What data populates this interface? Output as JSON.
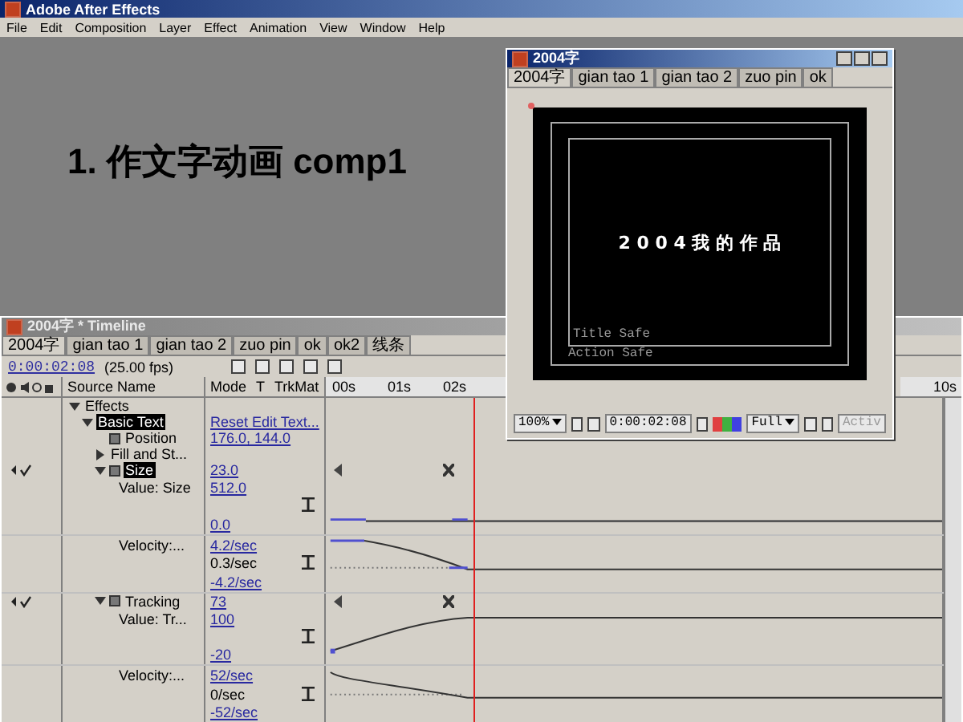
{
  "app": {
    "title": "Adobe After Effects",
    "menu": [
      "File",
      "Edit",
      "Composition",
      "Layer",
      "Effect",
      "Animation",
      "View",
      "Window",
      "Help"
    ]
  },
  "heading": "1. 作文字动画 comp1",
  "comp_window": {
    "title": "2004字",
    "tabs": [
      {
        "label": "2004字",
        "selected": true
      },
      {
        "label": "gian tao 1",
        "selected": false
      },
      {
        "label": "gian tao 2",
        "selected": false
      },
      {
        "label": "zuo pin",
        "selected": false
      },
      {
        "label": "ok",
        "selected": false
      }
    ],
    "preview_text": "2 0 0 4 我 的 作 品",
    "title_safe": "Title Safe",
    "action_safe": "Action Safe",
    "zoom": "100%",
    "timecode": "0:00:02:08",
    "resolution": "Full",
    "view": "Activ"
  },
  "timeline": {
    "title": "2004字 * Timeline",
    "tabs": [
      {
        "label": "2004字",
        "selected": true
      },
      {
        "label": "gian tao 1",
        "selected": false
      },
      {
        "label": "gian tao 2",
        "selected": false
      },
      {
        "label": "zuo pin",
        "selected": false
      },
      {
        "label": "ok",
        "selected": false
      },
      {
        "label": "ok2",
        "selected": false
      },
      {
        "label": "线条",
        "selected": false
      }
    ],
    "timecode": "0:00:02:08",
    "fps": "(25.00 fps)",
    "columns": [
      "Source Name",
      "Mode",
      "T",
      "TrkMat"
    ],
    "ruler": [
      "00s",
      "01s",
      "02s"
    ],
    "ruler_end": "10s",
    "rows": [
      {
        "kind": "property",
        "name": "Effects",
        "expanded": true,
        "selected": false,
        "children": [
          {
            "kind": "property",
            "name": "Basic Text",
            "value": "Reset Edit Text...",
            "expanded": true,
            "selected": true,
            "children": [
              {
                "kind": "property",
                "name": "Position",
                "value": "176.0, 144.0",
                "stopwatch": true,
                "selected": false
              },
              {
                "kind": "property",
                "name": "Fill and St...",
                "expanded": false,
                "selected": false
              },
              {
                "kind": "property",
                "name": "Size",
                "value": "23.0",
                "expanded": true,
                "selected": true,
                "stopwatch": true,
                "keyframed": true,
                "children": [
                  {
                    "kind": "graph",
                    "name": "Value: Size",
                    "labels": [
                      "512.0",
                      "0.0"
                    ]
                  },
                  {
                    "kind": "graph",
                    "name": "Velocity:...",
                    "labels": [
                      "4.2/sec",
                      "0.3/sec",
                      "-4.2/sec"
                    ]
                  }
                ]
              },
              {
                "kind": "property",
                "name": "Tracking",
                "value": "73",
                "expanded": true,
                "selected": false,
                "stopwatch": true,
                "keyframed": true,
                "children": [
                  {
                    "kind": "graph",
                    "name": "Value: Tr...",
                    "labels": [
                      "100",
                      "-20"
                    ]
                  },
                  {
                    "kind": "graph",
                    "name": "Velocity:...",
                    "labels": [
                      "52/sec",
                      "0/sec",
                      "-52/sec"
                    ]
                  }
                ]
              }
            ]
          }
        ]
      }
    ]
  }
}
